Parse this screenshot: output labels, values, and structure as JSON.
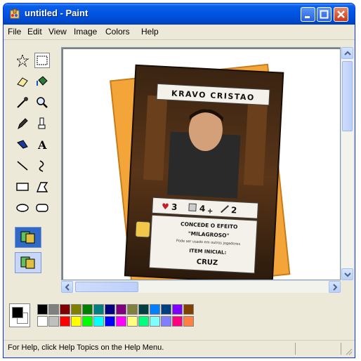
{
  "window": {
    "title": "untitled - Paint"
  },
  "menu": [
    "File",
    "Edit",
    "View",
    "Image",
    "Colors",
    "Help"
  ],
  "tools": [
    "free-form-select",
    "select",
    "eraser",
    "fill-with-color",
    "pick-color",
    "magnifier",
    "pencil",
    "brush",
    "airbrush",
    "text",
    "line",
    "curve",
    "rectangle",
    "polygon",
    "ellipse",
    "rounded-rectangle"
  ],
  "card": {
    "name": "KRAVO CRISTAO",
    "stat_hearts": "3",
    "stat_dice": "4",
    "stat_dice_plus": "+",
    "stat_sword": "2",
    "effect_line1": "CONCEDE O EFEITO",
    "effect_line2": "\"MILAGROSO\"",
    "effect_note": "Pode ser usado em outros jogadores",
    "item_label": "ITEM INICIAL:",
    "item_value": "CRUZ"
  },
  "palette": {
    "top": [
      "#000000",
      "#808080",
      "#800000",
      "#808000",
      "#008000",
      "#008080",
      "#000080",
      "#800080",
      "#808040",
      "#004040",
      "#0080ff",
      "#004080",
      "#8000ff",
      "#804000"
    ],
    "bottom": [
      "#ffffff",
      "#c0c0c0",
      "#ff0000",
      "#ffff00",
      "#00ff00",
      "#00ffff",
      "#0000ff",
      "#ff00ff",
      "#ffff80",
      "#00ff80",
      "#80ffff",
      "#8080ff",
      "#ff0080",
      "#ff8040"
    ],
    "foreground": "#000000",
    "background": "#ffffff"
  },
  "status": {
    "text": "For Help, click Help Topics on the Help Menu."
  },
  "colors": {
    "titlebar": "#0054e3",
    "chrome": "#ece9d8",
    "card_border": "#f0a020"
  }
}
